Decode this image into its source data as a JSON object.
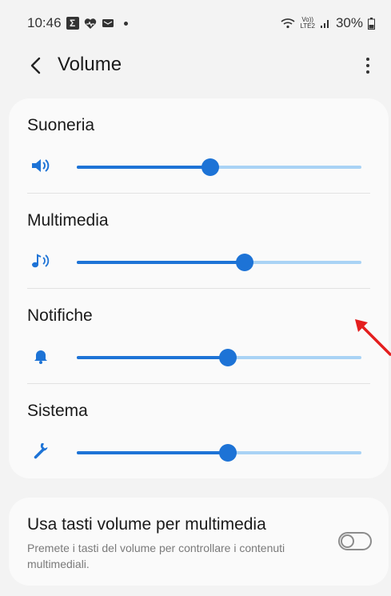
{
  "status_bar": {
    "time": "10:46",
    "notif_icon_letter": "Σ",
    "network_label_top": "Vo))",
    "network_label_bottom": "LTE2",
    "battery_text": "30%"
  },
  "header": {
    "title": "Volume"
  },
  "volumes": [
    {
      "label": "Suoneria",
      "icon": "ringtone-speaker-icon",
      "level": 0.47
    },
    {
      "label": "Multimedia",
      "icon": "music-note-icon",
      "level": 0.59
    },
    {
      "label": "Notifiche",
      "icon": "bell-icon",
      "level": 0.53
    },
    {
      "label": "Sistema",
      "icon": "wrench-icon",
      "level": 0.53
    }
  ],
  "media_keys_option": {
    "title": "Usa tasti volume per multimedia",
    "description": "Premete i tasti del volume per controllare i contenuti multimediali.",
    "enabled": false
  },
  "colors": {
    "accent": "#1d73d6",
    "track_light": "#a9d3f5",
    "background": "#f3f3f3",
    "card": "#fafafa",
    "annotation_arrow": "#e41e1e"
  }
}
